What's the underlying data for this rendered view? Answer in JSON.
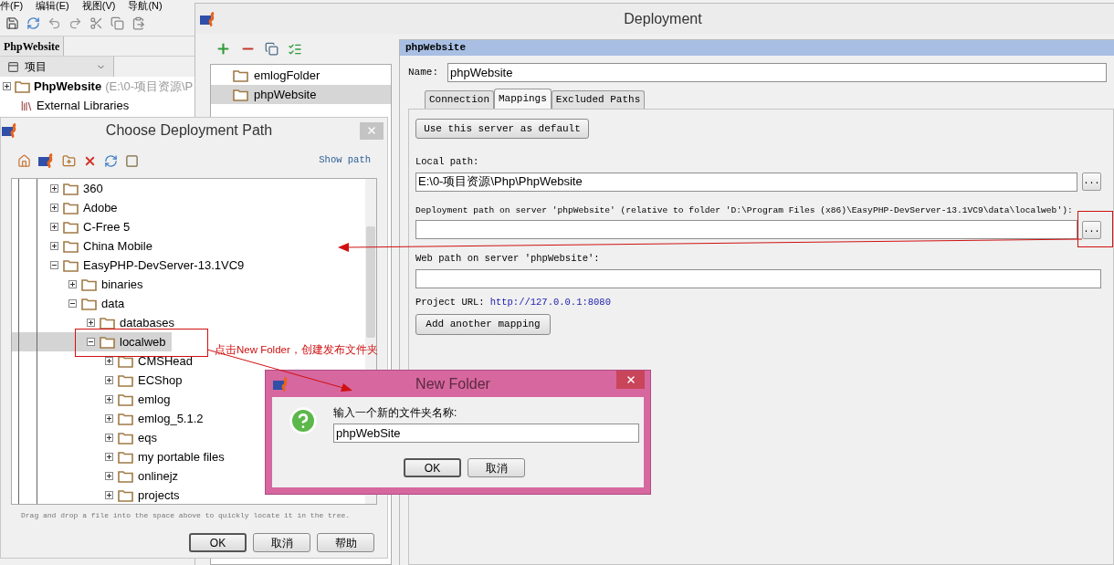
{
  "ide": {
    "menu": [
      "件(F)",
      "编辑(E)",
      "视图(V)",
      "导航(N)"
    ],
    "breadcrumb": "PhpWebsite",
    "view_selector": "项目",
    "tree": [
      {
        "label": "PhpWebsite",
        "path": "(E:\\0-项目资源\\P",
        "expanded": false,
        "kind": "project"
      },
      {
        "label": "External Libraries",
        "kind": "libraries"
      }
    ]
  },
  "deployment": {
    "title": "Deployment",
    "servers": [
      {
        "name": "emlogFolder",
        "selected": false
      },
      {
        "name": "phpWebsite",
        "selected": true
      }
    ],
    "server_header": "phpWebsite",
    "name_label": "Name:",
    "name_value": "phpWebsite",
    "tabs": [
      {
        "label": "Connection",
        "selected": false
      },
      {
        "label": "Mappings",
        "selected": true
      },
      {
        "label": "Excluded Paths",
        "selected": false
      }
    ],
    "default_button": "Use this server as default",
    "local_path_label": "Local path:",
    "local_path": "E:\\0-项目资源\\Php\\PhpWebsite",
    "local_browse": "...",
    "deployment_path_label": "Deployment path on server 'phpWebsite' (relative to folder 'D:\\Program Files (x86)\\EasyPHP-DevServer-13.1VC9\\data\\localweb'):",
    "deployment_browse": "...",
    "web_path_label": "Web path on server 'phpWebsite':",
    "project_url_label": "Project URL:",
    "project_url": "http://127.0.0.1:8080",
    "add_mapping_button": "Add another mapping"
  },
  "choose_dialog": {
    "title": "Choose Deployment Path",
    "show_path": "Show path",
    "tree": [
      {
        "label": "360",
        "expanded": false,
        "selected": false
      },
      {
        "label": "Adobe",
        "expanded": false,
        "selected": false
      },
      {
        "label": "C-Free 5",
        "expanded": false,
        "selected": false
      },
      {
        "label": "China Mobile",
        "expanded": false,
        "selected": false
      },
      {
        "label": "EasyPHP-DevServer-13.1VC9",
        "expanded": true,
        "selected": false,
        "children": [
          {
            "label": "binaries",
            "expanded": false,
            "selected": false
          },
          {
            "label": "data",
            "expanded": true,
            "selected": false,
            "children": [
              {
                "label": "databases",
                "expanded": false,
                "selected": false
              },
              {
                "label": "localweb",
                "expanded": true,
                "selected": true,
                "children": [
                  {
                    "label": "CMSHead",
                    "expanded": false,
                    "selected": false
                  },
                  {
                    "label": "ECShop",
                    "expanded": false,
                    "selected": false
                  },
                  {
                    "label": "emlog",
                    "expanded": false,
                    "selected": false
                  },
                  {
                    "label": "emlog_5.1.2",
                    "expanded": false,
                    "selected": false
                  },
                  {
                    "label": "eqs",
                    "expanded": false,
                    "selected": false
                  },
                  {
                    "label": "my portable files",
                    "expanded": false,
                    "selected": false
                  },
                  {
                    "label": "onlinejz",
                    "expanded": false,
                    "selected": false
                  },
                  {
                    "label": "projects",
                    "expanded": false,
                    "selected": false
                  }
                ]
              }
            ]
          }
        ]
      }
    ],
    "hint": "Drag and drop a file into the space above to quickly locate it in the tree.",
    "buttons": [
      {
        "label": "OK",
        "default": true
      },
      {
        "label": "取消",
        "default": false
      },
      {
        "label": "帮助",
        "default": false
      }
    ]
  },
  "new_folder_dialog": {
    "title": "New Folder",
    "prompt": "输入一个新的文件夹名称:",
    "value": "phpWebSite",
    "buttons": [
      {
        "label": "OK",
        "default": true
      },
      {
        "label": "取消",
        "default": false
      }
    ]
  },
  "annotation": {
    "text": "点击New Folder，创建发布文件夹"
  }
}
